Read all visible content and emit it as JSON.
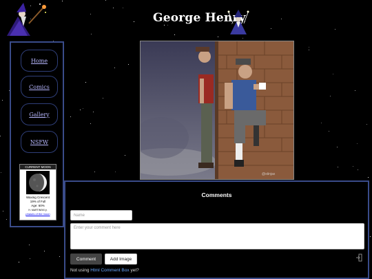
{
  "site": {
    "title": "George Henry"
  },
  "nav": [
    {
      "label": "Home"
    },
    {
      "label": "Comics"
    },
    {
      "label": "Gallery"
    },
    {
      "label": "NSFW"
    }
  ],
  "moon": {
    "header": "CURRENT MOON",
    "phase": "Waxing Crescent",
    "percent": "19% of Full",
    "age": "Age: 60%",
    "extra": "H. MARTINSKI jr.",
    "link": "phases of the moon"
  },
  "comic": {
    "signature": "@stinjax"
  },
  "comments": {
    "heading": "Comments",
    "name_placeholder": "Name",
    "comment_placeholder": "Enter your comment here",
    "comment_button": "Comment",
    "add_image_button": "Add Image",
    "footer_prefix": "Not using",
    "footer_link": "Html Comment Box",
    "footer_suffix": "yet?"
  }
}
